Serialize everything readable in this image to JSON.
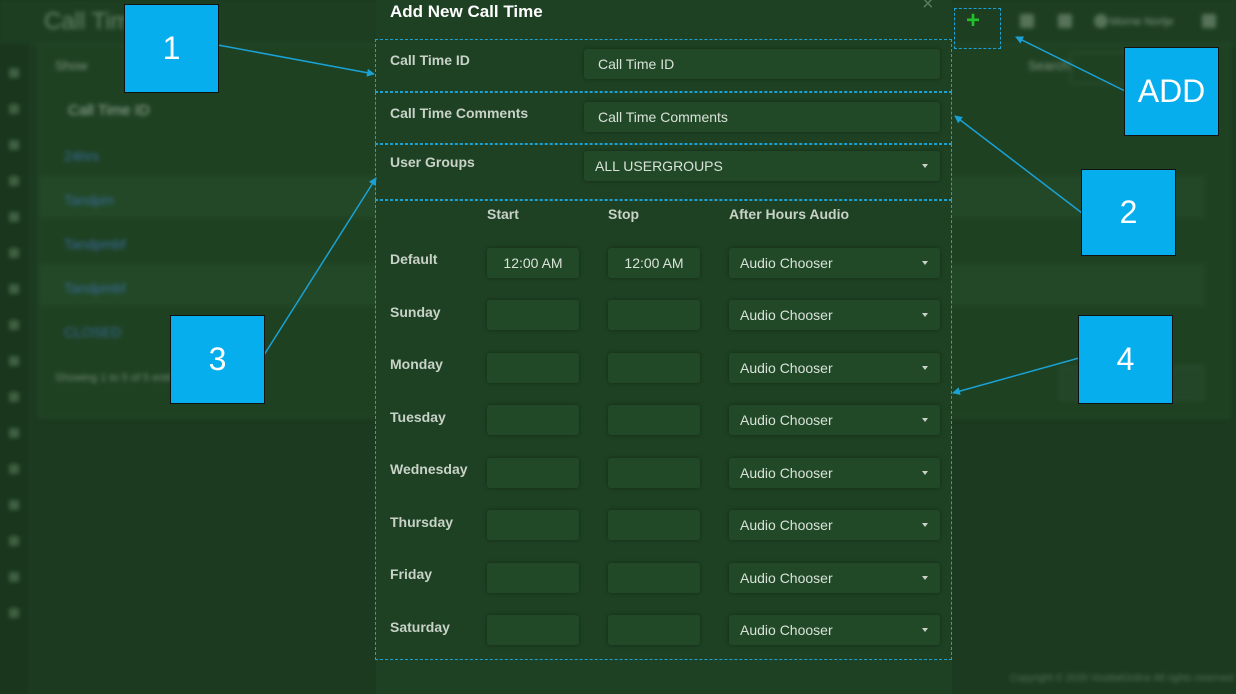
{
  "background": {
    "title": "Call Time",
    "show_label": "Show",
    "column_header": "Call Time ID",
    "rows": [
      "24hrs",
      "Tandpm",
      "Tandpmbf",
      "Tandpmbf",
      "CLOSED"
    ],
    "showing_text": "Showing 1 to 5 of 5 entries",
    "search_label": "Search:",
    "user_name": "Morne Nortje",
    "footer": "Copyright © 2020 VicidialOnline All rights reserved"
  },
  "modal": {
    "title": "Add New Call Time",
    "close": "×",
    "call_time_id": {
      "label": "Call Time ID",
      "placeholder": "Call Time ID"
    },
    "comments": {
      "label": "Call Time Comments",
      "placeholder": "Call Time Comments"
    },
    "user_groups": {
      "label": "User Groups",
      "value": "ALL USERGROUPS"
    },
    "columns": {
      "start": "Start",
      "stop": "Stop",
      "audio": "After Hours Audio"
    },
    "days": [
      {
        "name": "Default",
        "start": "12:00 AM",
        "stop": "12:00 AM",
        "audio": "Audio Chooser"
      },
      {
        "name": "Sunday",
        "start": "",
        "stop": "",
        "audio": "Audio Chooser"
      },
      {
        "name": "Monday",
        "start": "",
        "stop": "",
        "audio": "Audio Chooser"
      },
      {
        "name": "Tuesday",
        "start": "",
        "stop": "",
        "audio": "Audio Chooser"
      },
      {
        "name": "Wednesday",
        "start": "",
        "stop": "",
        "audio": "Audio Chooser"
      },
      {
        "name": "Thursday",
        "start": "",
        "stop": "",
        "audio": "Audio Chooser"
      },
      {
        "name": "Friday",
        "start": "",
        "stop": "",
        "audio": "Audio Chooser"
      },
      {
        "name": "Saturday",
        "start": "",
        "stop": "",
        "audio": "Audio Chooser"
      }
    ]
  },
  "annotations": {
    "one": "1",
    "two": "2",
    "three": "3",
    "four": "4",
    "add": "ADD",
    "plus": "+"
  },
  "colors": {
    "callout": "#06aeed",
    "dash": "#1aa2d6",
    "plus": "#22c02b"
  }
}
